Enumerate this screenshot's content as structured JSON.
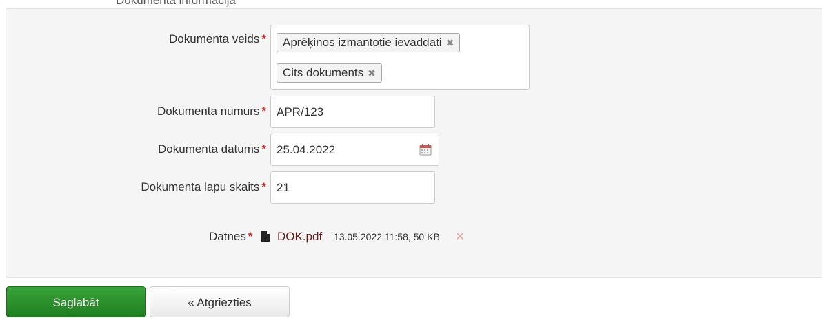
{
  "heading": "Dokumenta informācija",
  "form": {
    "required_mark": "*",
    "document_type": {
      "label": "Dokumenta veids",
      "tags": [
        "Aprēķinos izmantotie ievaddati",
        "Cits dokuments"
      ],
      "remove_glyph": "✖"
    },
    "document_number": {
      "label": "Dokumenta numurs",
      "value": "APR/123"
    },
    "document_date": {
      "label": "Dokumenta datums",
      "value": "25.04.2022"
    },
    "page_count": {
      "label": "Dokumenta lapu skaits",
      "value": "21"
    },
    "files": {
      "label": "Datnes",
      "items": [
        {
          "name": "DOK.pdf",
          "meta": "13.05.2022 11:58, 50 KB",
          "remove_glyph": "✕"
        }
      ]
    }
  },
  "buttons": {
    "save": "Saglabāt",
    "back": "« Atgriezties"
  },
  "colors": {
    "required": "#c9302c",
    "save_button": "#2a8f2a",
    "file_link": "#6b1a1a"
  }
}
